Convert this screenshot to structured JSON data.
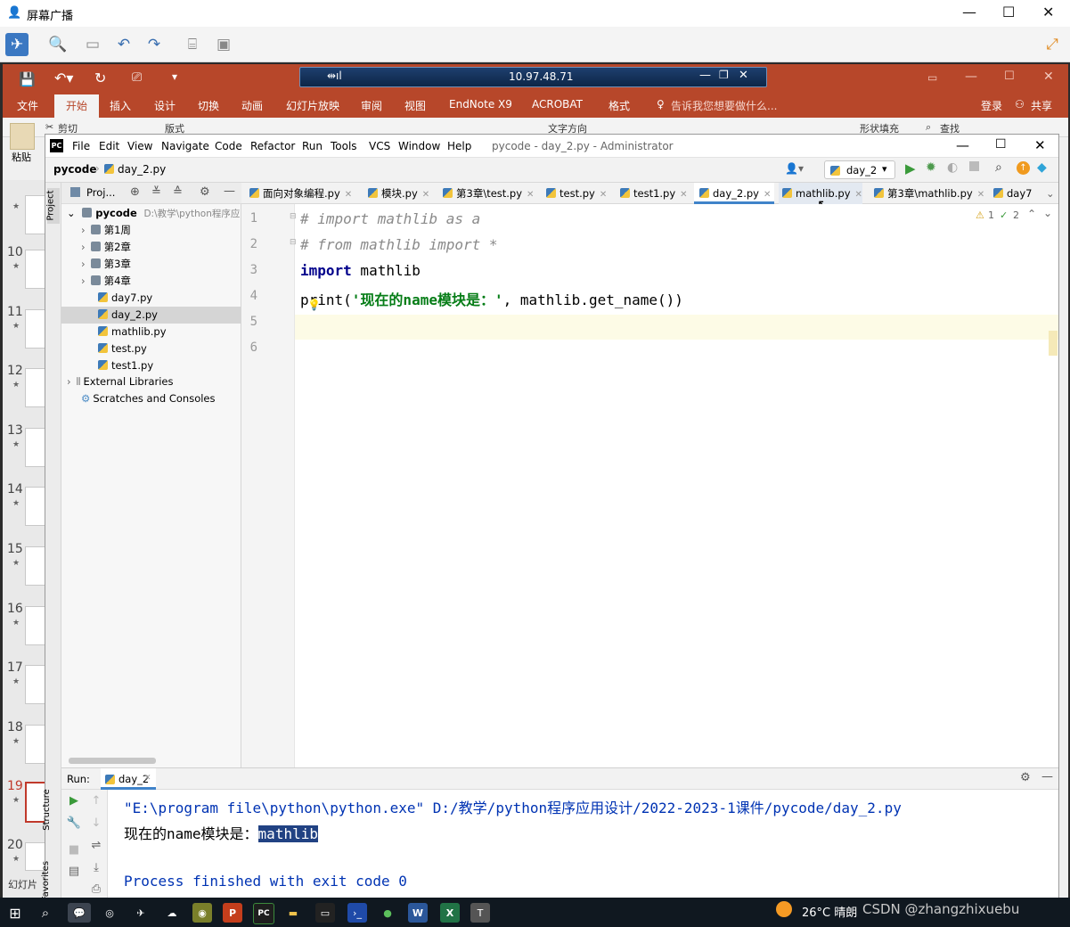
{
  "host": {
    "title": "屏幕广播",
    "minimize": "—",
    "maximize": "☐",
    "close": "✕"
  },
  "ppt": {
    "rdp_host": "10.97.48.71",
    "ribbon_tabs": [
      "文件",
      "开始",
      "插入",
      "设计",
      "切换",
      "动画",
      "幻灯片放映",
      "审阅",
      "视图",
      "EndNote X9",
      "ACROBAT",
      "格式"
    ],
    "tell_me": "告诉我您想要做什么...",
    "login": "登录",
    "share": "共享",
    "ribbon_cut": "剪切",
    "ribbon_layout": "版式",
    "ribbon_text_dir": "文字方向",
    "ribbon_shape_fill": "形状填充",
    "ribbon_find": "查找",
    "paste": "粘贴",
    "clipboard": "剪贴",
    "slides_label": "幻灯片",
    "slide_numbers": [
      "10",
      "11",
      "12",
      "13",
      "14",
      "15",
      "16",
      "17",
      "18",
      "19",
      "20"
    ]
  },
  "pycharm": {
    "menus": [
      "File",
      "Edit",
      "View",
      "Navigate",
      "Code",
      "Refactor",
      "Run",
      "Tools",
      "VCS",
      "Window",
      "Help"
    ],
    "title": "pycode - day_2.py - Administrator",
    "breadcrumb_project": "pycode",
    "breadcrumb_file": "day_2.py",
    "run_config": "day_2",
    "project_panel_label": "Proj...",
    "left_strip_project": "Project",
    "left_strip_structure": "Structure",
    "left_strip_favorites": "Favorites",
    "project_root": "pycode",
    "project_root_path": "D:\\教学\\python程序应",
    "tree": [
      {
        "label": "第1周",
        "type": "folder"
      },
      {
        "label": "第2章",
        "type": "folder"
      },
      {
        "label": "第3章",
        "type": "folder"
      },
      {
        "label": "第4章",
        "type": "folder"
      },
      {
        "label": "day7.py",
        "type": "file"
      },
      {
        "label": "day_2.py",
        "type": "file",
        "selected": true
      },
      {
        "label": "mathlib.py",
        "type": "file"
      },
      {
        "label": "test.py",
        "type": "file"
      },
      {
        "label": "test1.py",
        "type": "file"
      }
    ],
    "external_libraries": "External Libraries",
    "scratches": "Scratches and Consoles",
    "editor_tabs": [
      "面向对象编程.py",
      "模块.py",
      "第3章\\test.py",
      "test.py",
      "test1.py",
      "day_2.py",
      "mathlib.py",
      "第3章\\mathlib.py",
      "day7"
    ],
    "active_tab": "day_2.py",
    "inspections_warn": "1",
    "inspections_ok": "2",
    "line_numbers": [
      "1",
      "2",
      "3",
      "4",
      "5",
      "6"
    ],
    "code": {
      "l1": "# import mathlib as a",
      "l2": "# from mathlib import *",
      "l3_kw": "import",
      "l3_rest": " mathlib",
      "l4_fn": "print(",
      "l4_str": "'现在的name模块是：'",
      "l4_rest": ", mathlib.get_name())"
    },
    "run_label": "Run:",
    "run_tab": "day_2",
    "console": {
      "cmd": "\"E:\\program file\\python\\python.exe\" D:/教学/python程序应用设计/2022-2023-1课件/pycode/day_2.py",
      "out_prefix": "现在的name模块是：",
      "out_selected": "mathlib",
      "exit": "Process finished with exit code 0"
    }
  },
  "taskbar": {
    "weather": "26°C  晴朗",
    "watermark": "CSDN @zhangzhixuebu"
  },
  "colors": {
    "ppt_red": "#b7472a",
    "pycharm_selection": "#214283",
    "keyword": "#00008b",
    "string": "#067d17"
  }
}
